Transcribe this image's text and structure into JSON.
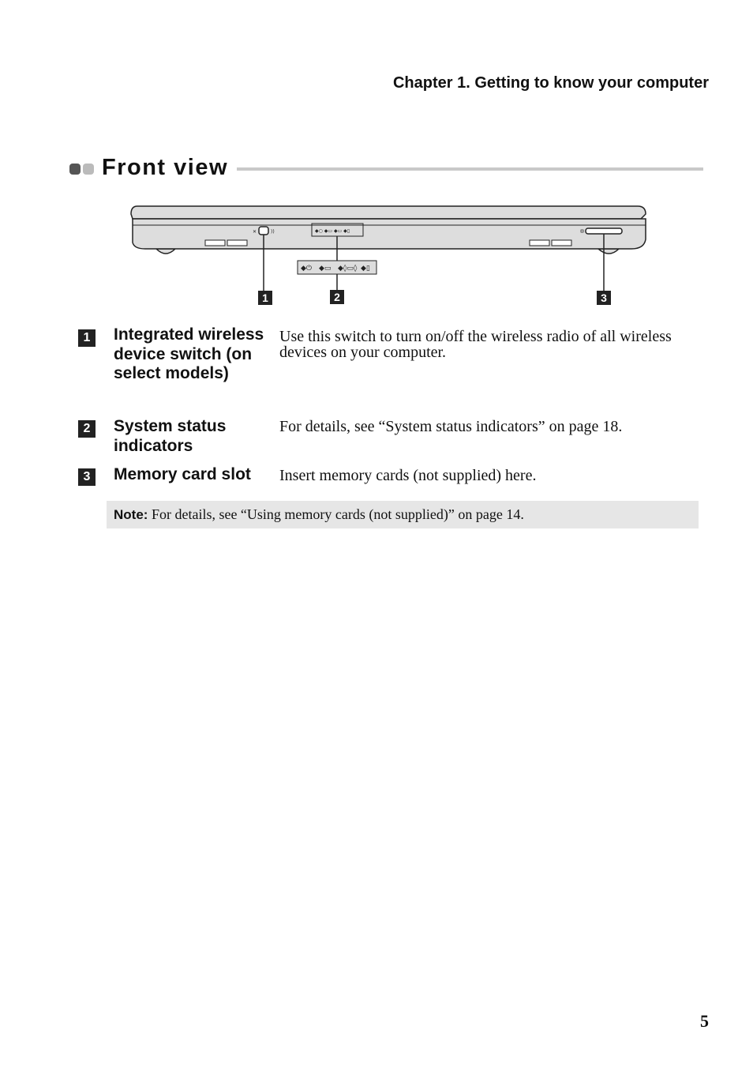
{
  "header": {
    "chapter_title": "Chapter 1. Getting to know your computer"
  },
  "section": {
    "title": "Front view"
  },
  "figure": {
    "description": "Front view of laptop with numbered callouts",
    "callouts": [
      "1",
      "2",
      "3"
    ],
    "indicator_icons": [
      "power-icon",
      "battery-icon",
      "wireless-icon",
      "hdd-icon"
    ]
  },
  "items": [
    {
      "number": "1",
      "label": "Integrated wireless device switch (on select models)",
      "description": "Use this switch to turn on/off the wireless radio of all wireless devices on your computer."
    },
    {
      "number": "2",
      "label": "System status indicators",
      "description": "For details, see “System status indicators” on page 18."
    },
    {
      "number": "3",
      "label": "Memory card slot",
      "description": "Insert memory cards (not supplied) here."
    }
  ],
  "note": {
    "label": "Note:",
    "text": " For details, see “Using memory cards (not supplied)” on page 14."
  },
  "footer": {
    "page_number": "5"
  },
  "colors": {
    "callout_bg": "#222222",
    "note_bg": "#e6e6e6",
    "rule": "#c9c9c9",
    "laptop_fill": "#dddddd"
  }
}
